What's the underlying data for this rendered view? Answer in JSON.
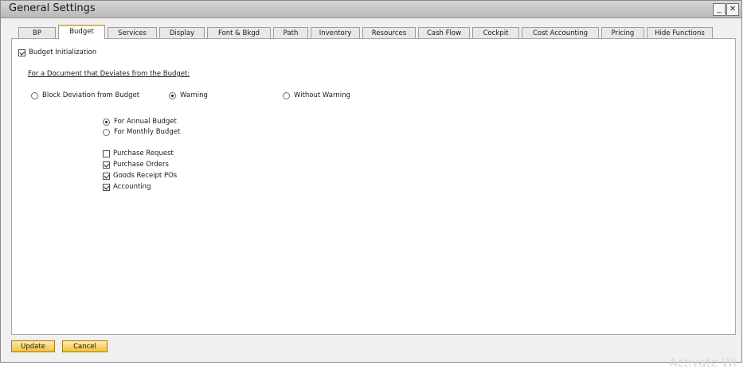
{
  "window": {
    "title": "General Settings",
    "minimize_label": "_",
    "close_label": "✕"
  },
  "tabs": [
    {
      "label": "BP",
      "active": false
    },
    {
      "label": "Budget",
      "active": true
    },
    {
      "label": "Services",
      "active": false
    },
    {
      "label": "Display",
      "active": false
    },
    {
      "label": "Font & Bkgd",
      "active": false
    },
    {
      "label": "Path",
      "active": false
    },
    {
      "label": "Inventory",
      "active": false
    },
    {
      "label": "Resources",
      "active": false
    },
    {
      "label": "Cash Flow",
      "active": false
    },
    {
      "label": "Cockpit",
      "active": false
    },
    {
      "label": "Cost Accounting",
      "active": false
    },
    {
      "label": "Pricing",
      "active": false
    },
    {
      "label": "Hide Functions",
      "active": false
    }
  ],
  "budget": {
    "initialization": {
      "label": "Budget Initialization",
      "checked": true
    },
    "deviation_heading": "For a Document that Deviates from the Budget:",
    "deviation_options": [
      {
        "label": "Block Deviation from Budget",
        "selected": false
      },
      {
        "label": "Warning",
        "selected": true
      },
      {
        "label": "Without Warning",
        "selected": false
      }
    ],
    "period_options": [
      {
        "label": "For Annual Budget",
        "selected": true
      },
      {
        "label": "For Monthly Budget",
        "selected": false
      }
    ],
    "documents": [
      {
        "label": "Purchase Request",
        "checked": false
      },
      {
        "label": "Purchase Orders",
        "checked": true
      },
      {
        "label": "Goods Receipt POs",
        "checked": true
      },
      {
        "label": "Accounting",
        "checked": true
      }
    ]
  },
  "buttons": {
    "update": "Update",
    "cancel": "Cancel"
  },
  "watermark": "Activate Wi"
}
